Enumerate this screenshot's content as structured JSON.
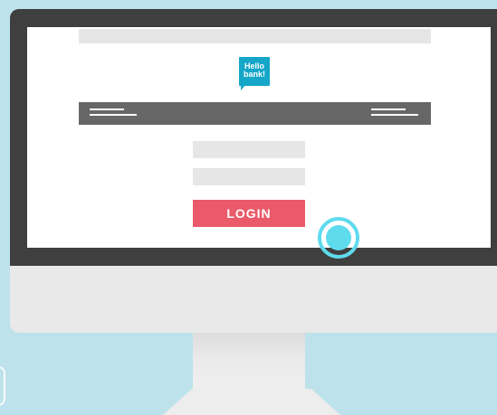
{
  "logo": {
    "line1": "Hello",
    "line2": "bank!",
    "color": "#15a6c8"
  },
  "login": {
    "button_label": "LOGIN",
    "button_color": "#ea5a6a"
  },
  "colors": {
    "background": "#bde2eb",
    "bezel": "#3f3f3f",
    "nav_bar": "#676767",
    "touch_indicator": "#5fdbee"
  }
}
